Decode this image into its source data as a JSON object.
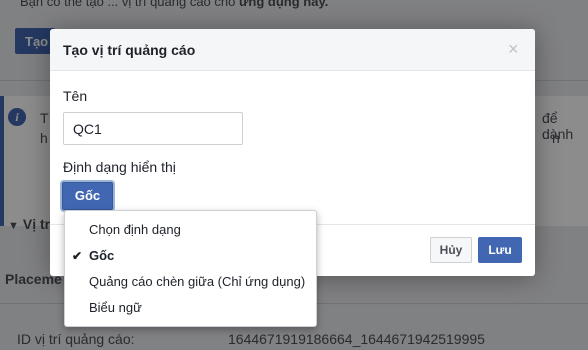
{
  "background": {
    "top_text": "Bạn có thể tạo ... vị trí quảng cáo cho",
    "top_text_bold": "ứng dụng này.",
    "create_button_label": "Tạo",
    "info_text_line1": "T",
    "info_text_line2": "h",
    "info_text_right": "để dành",
    "info_text_right2": "n",
    "section_label": "Vị tr",
    "placement_label": "Placeme",
    "id_label": "ID vị trí quảng cáo:",
    "id_value": "1644671919186664_1644671942519995"
  },
  "modal": {
    "title": "Tạo vị trí quảng cáo",
    "close_symbol": "×",
    "name_label": "Tên",
    "name_value": "QC1",
    "format_label": "Định dạng hiển thị",
    "format_selected": "Gốc",
    "cancel_label": "Hủy",
    "save_label": "Lưu"
  },
  "dropdown": {
    "items": [
      {
        "label": "Chọn định dạng",
        "selected": false
      },
      {
        "label": "Gốc",
        "selected": true
      },
      {
        "label": "Quảng cáo chèn giữa (Chỉ ứng dụng)",
        "selected": false
      },
      {
        "label": "Biểu ngữ",
        "selected": false
      }
    ],
    "check_symbol": "✔"
  },
  "colors": {
    "primary": "#4267b2",
    "overlay": "rgba(0,0,0,0.45)"
  }
}
